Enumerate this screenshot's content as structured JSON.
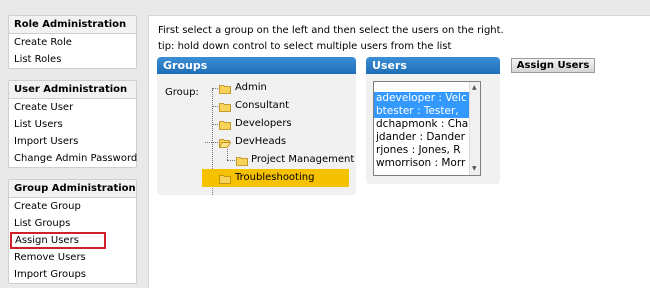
{
  "sidebar": {
    "role_admin": {
      "title": "Role Administration",
      "items": [
        "Create Role",
        "List Roles"
      ]
    },
    "user_admin": {
      "title": "User Administration",
      "items": [
        "Create User",
        "List Users",
        "Import Users",
        "Change Admin Password"
      ]
    },
    "group_admin": {
      "title": "Group Administration",
      "items": [
        "Create Group",
        "List Groups",
        "Assign Users",
        "Remove Users",
        "Import Groups"
      ]
    }
  },
  "main": {
    "instruction": "First select a group on the left and then select the users on the right.",
    "tip": "tip: hold down control to select multiple users from the list",
    "groups_header": "Groups",
    "group_label": "Group:",
    "tree": [
      "Admin",
      "Consultant",
      "Developers",
      "DevHeads",
      "Project Management",
      "Troubleshooting"
    ],
    "selected_group": "Troubleshooting",
    "users_header": "Users",
    "users": [
      "adeveloper : Velc",
      "btester : Tester,",
      "dchapmonk : Cha",
      "jdander : Dander",
      "rjones : Jones, R",
      "wmorrison : Morr"
    ],
    "selected_users": [
      "adeveloper : Velc",
      "btester : Tester,"
    ],
    "assign_button": "Assign Users"
  },
  "colors": {
    "panel_header": "#1f6db8",
    "selected_group": "#f6c200",
    "selected_user": "#3399ff",
    "highlight_outline": "#d0202a"
  },
  "icons": {
    "tree_node": "folder-icon"
  }
}
